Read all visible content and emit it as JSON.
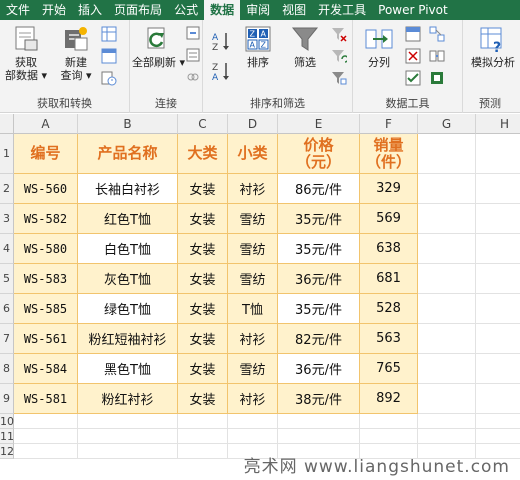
{
  "ribbon": {
    "tabs": [
      {
        "name": "file",
        "label": "文件"
      },
      {
        "name": "home",
        "label": "开始"
      },
      {
        "name": "insert",
        "label": "插入"
      },
      {
        "name": "page-layout",
        "label": "页面布局"
      },
      {
        "name": "formulas",
        "label": "公式"
      },
      {
        "name": "data",
        "label": "数据"
      },
      {
        "name": "review",
        "label": "审阅"
      },
      {
        "name": "view",
        "label": "视图"
      },
      {
        "name": "developer",
        "label": "开发工具"
      },
      {
        "name": "power-pivot",
        "label": "Power Pivot"
      }
    ],
    "active_tab": "数据",
    "groups": {
      "get_transform": {
        "label": "获取和转换",
        "get_data_line1": "获取",
        "get_data_line2": "部数据",
        "new_query_line1": "新建",
        "new_query_line2": "查询"
      },
      "connections": {
        "label": "连接",
        "refresh_all": "全部刷新"
      },
      "sort_filter": {
        "label": "排序和筛选",
        "sort": "排序",
        "filter": "筛选"
      },
      "data_tools": {
        "label": "数据工具",
        "text_to_columns": "分列"
      },
      "forecast": {
        "label": "预测",
        "what_if": "模拟分析"
      }
    }
  },
  "sheet": {
    "columns": [
      "A",
      "B",
      "C",
      "D",
      "E",
      "F",
      "G",
      "H"
    ],
    "row_numbers": [
      "1",
      "2",
      "3",
      "4",
      "5",
      "6",
      "7",
      "8",
      "9",
      "10",
      "11",
      "12"
    ],
    "headers": {
      "id": "编号",
      "product": "产品名称",
      "category": "大类",
      "subcategory": "小类",
      "price_line1": "价格",
      "price_line2": "（元）",
      "sales_line1": "销量",
      "sales_line2": "（件）"
    },
    "rows": [
      {
        "id": "WS-560",
        "product": "长袖白衬衫",
        "category": "女装",
        "subcategory": "衬衫",
        "price": "86元/件",
        "sales": "329"
      },
      {
        "id": "WS-582",
        "product": "红色T恤",
        "category": "女装",
        "subcategory": "雪纺",
        "price": "35元/件",
        "sales": "569"
      },
      {
        "id": "WS-580",
        "product": "白色T恤",
        "category": "女装",
        "subcategory": "雪纺",
        "price": "35元/件",
        "sales": "638"
      },
      {
        "id": "WS-583",
        "product": "灰色T恤",
        "category": "女装",
        "subcategory": "雪纺",
        "price": "36元/件",
        "sales": "681"
      },
      {
        "id": "WS-585",
        "product": "绿色T恤",
        "category": "女装",
        "subcategory": "T恤",
        "price": "35元/件",
        "sales": "528"
      },
      {
        "id": "WS-561",
        "product": "粉红短袖衬衫",
        "category": "女装",
        "subcategory": "衬衫",
        "price": "82元/件",
        "sales": "563"
      },
      {
        "id": "WS-584",
        "product": "黑色T恤",
        "category": "女装",
        "subcategory": "雪纺",
        "price": "36元/件",
        "sales": "765"
      },
      {
        "id": "WS-581",
        "product": "粉红衬衫",
        "category": "女装",
        "subcategory": "衬衫",
        "price": "38元/件",
        "sales": "892"
      }
    ]
  },
  "watermark": "亮术网 www.liangshunet.com",
  "colors": {
    "excel_green": "#217346",
    "header_text": "#e07020",
    "band_fill": "#fff2cc",
    "table_border": "#f2c46d"
  }
}
